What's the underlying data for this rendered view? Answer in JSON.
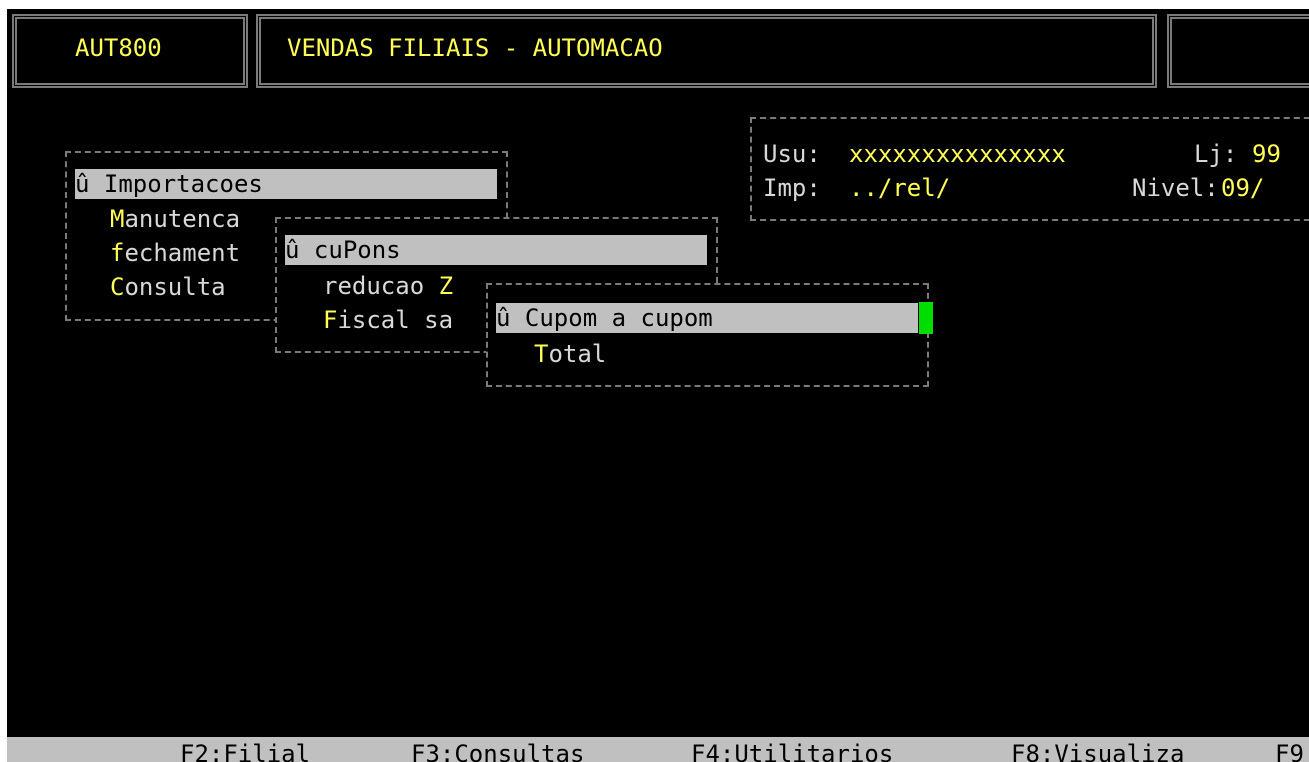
{
  "header": {
    "program_code": "AUT800",
    "title": "VENDAS FILIAIS - AUTOMACAO"
  },
  "info": {
    "usu_label": "Usu:",
    "usu_value": "xxxxxxxxxxxxxxx",
    "lj_label": "Lj:",
    "lj_value": "99",
    "imp_label": "Imp:",
    "imp_value": "../rel/",
    "nivel_label": "Nivel:",
    "nivel_value": "09/"
  },
  "menu_main": {
    "items": [
      {
        "hotkey": "I",
        "rest": "mportacoes",
        "marker": "û"
      },
      {
        "hotkey": "M",
        "rest": "anutenca"
      },
      {
        "hotkey": "f",
        "rest": "echament"
      },
      {
        "hotkey": "C",
        "rest": "onsulta"
      }
    ]
  },
  "menu_cupons": {
    "items": [
      {
        "pre": "cu",
        "hotkey": "P",
        "rest": "ons",
        "marker": "û"
      },
      {
        "pre": "reducao ",
        "hotkey": "Z",
        "rest": ""
      },
      {
        "pre": "",
        "hotkey": "F",
        "rest": "iscal sa"
      }
    ]
  },
  "menu_cupom": {
    "items": [
      {
        "hotkey": "C",
        "rest": "upom a cupom",
        "marker": "û"
      },
      {
        "hotkey": "T",
        "rest": "otal"
      }
    ]
  },
  "function_keys": [
    "F2:Filial",
    "F3:Consultas",
    "F4:Utilitarios",
    "F8:Visualiza",
    "F9"
  ]
}
